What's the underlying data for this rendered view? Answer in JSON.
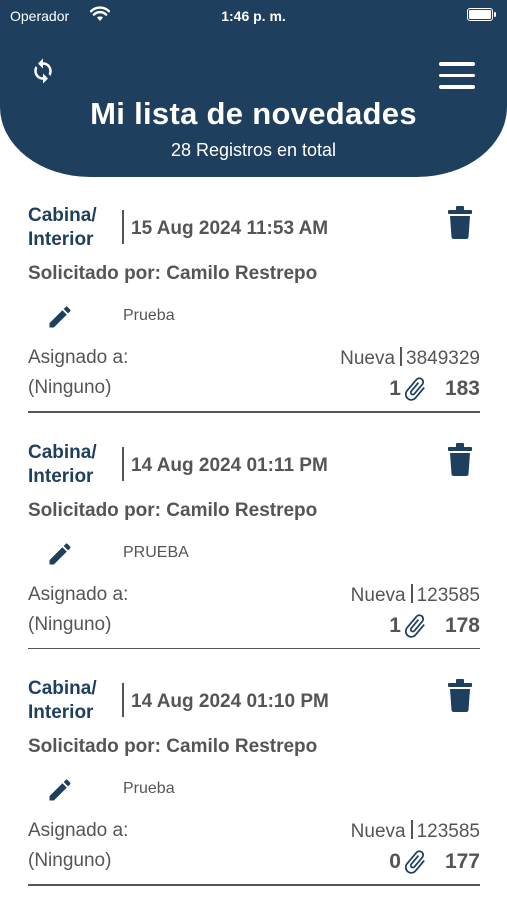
{
  "status_bar": {
    "carrier": "Operador",
    "time": "1:46 p. m."
  },
  "header": {
    "title": "Mi lista de novedades",
    "subtitle": "28 Registros en total",
    "icons": {
      "refresh": "refresh-icon",
      "menu": "hamburger-menu-icon"
    }
  },
  "colors": {
    "primary": "#1f3f5e",
    "text": "#555555",
    "background": "#ffffff"
  },
  "items": [
    {
      "category_line1": "Cabina/",
      "category_line2": "Interior",
      "date": "15 Aug 2024 11:53 AM",
      "requester": "Solicitado por: Camilo Restrepo",
      "description": "Prueba",
      "assigned_label": "Asignado a:",
      "assigned_value": "(Ninguno)",
      "status": "Nueva",
      "code": "3849329",
      "attachments": "1",
      "number": "183"
    },
    {
      "category_line1": "Cabina/",
      "category_line2": "Interior",
      "date": "14 Aug 2024 01:11 PM",
      "requester": "Solicitado por: Camilo Restrepo",
      "description": "PRUEBA",
      "assigned_label": "Asignado a:",
      "assigned_value": "(Ninguno)",
      "status": "Nueva",
      "code": "123585",
      "attachments": "1",
      "number": "178"
    },
    {
      "category_line1": "Cabina/",
      "category_line2": "Interior",
      "date": "14 Aug 2024 01:10 PM",
      "requester": "Solicitado por: Camilo Restrepo",
      "description": "Prueba",
      "assigned_label": "Asignado a:",
      "assigned_value": "(Ninguno)",
      "status": "Nueva",
      "code": "123585",
      "attachments": "0",
      "number": "177"
    }
  ]
}
